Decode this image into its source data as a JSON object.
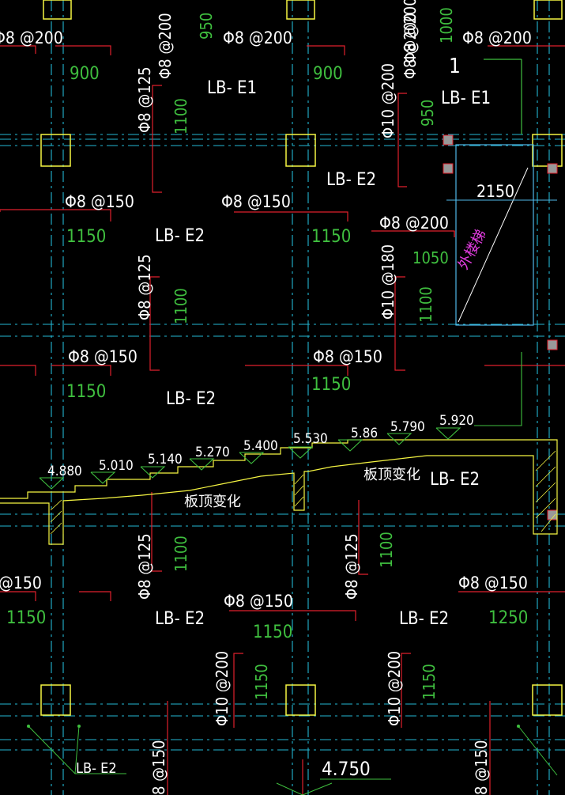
{
  "colors": {
    "background": "#000000",
    "grid_line": "#23b7d3",
    "rebar_line": "#e0202c",
    "column": "#f5f542",
    "dimension": "#3fbf3f",
    "text": "#ffffff",
    "magenta": "#e23ce0",
    "opening": "#4fb8e8"
  },
  "slabs": [
    {
      "label": "LB- E1"
    },
    {
      "label": "LB- E1"
    },
    {
      "label": "LB- E2"
    },
    {
      "label": "LB- E2"
    },
    {
      "label": "LB- E2"
    },
    {
      "label": "LB- E2"
    },
    {
      "label": "LB- E2"
    },
    {
      "label": "LB- E2"
    },
    {
      "label": "LB- E2"
    }
  ],
  "rebar_labels": [
    {
      "text": "Φ8 @200"
    },
    {
      "text": "Φ8 @200"
    },
    {
      "text": "Φ8 @200"
    },
    {
      "text": "Φ8 @200"
    },
    {
      "text": "Φ8 @200"
    },
    {
      "text": "Φ8 @200"
    },
    {
      "text": "Φ8 @125"
    },
    {
      "text": "Φ10 @200"
    },
    {
      "text": "Φ8 @150"
    },
    {
      "text": "Φ8 @150"
    },
    {
      "text": "Φ8 @200"
    },
    {
      "text": "Φ8 @125"
    },
    {
      "text": "Φ10 @180"
    },
    {
      "text": "Φ8 @150"
    },
    {
      "text": "Φ8 @150"
    },
    {
      "text": "Φ8 @125"
    },
    {
      "text": "Φ8 @125"
    },
    {
      "text": "@150"
    },
    {
      "text": "Φ8 @150"
    },
    {
      "text": "Φ8 @150"
    },
    {
      "text": "Φ10 @200"
    },
    {
      "text": "Φ10 @200"
    },
    {
      "text": "8 @150"
    },
    {
      "text": "8 @150"
    }
  ],
  "dimension_labels": [
    {
      "text": "950"
    },
    {
      "text": "1000"
    },
    {
      "text": "900"
    },
    {
      "text": "900"
    },
    {
      "text": "1100"
    },
    {
      "text": "950"
    },
    {
      "text": "1150"
    },
    {
      "text": "1150"
    },
    {
      "text": "1050"
    },
    {
      "text": "1100"
    },
    {
      "text": "1100"
    },
    {
      "text": "1150"
    },
    {
      "text": "1150"
    },
    {
      "text": "1100"
    },
    {
      "text": "1100"
    },
    {
      "text": "1150"
    },
    {
      "text": "1150"
    },
    {
      "text": "1250"
    },
    {
      "text": "1150"
    },
    {
      "text": "1150"
    }
  ],
  "elevations": [
    {
      "text": "4.880"
    },
    {
      "text": "5.010"
    },
    {
      "text": "5.140"
    },
    {
      "text": "5.270"
    },
    {
      "text": "5.400"
    },
    {
      "text": "5.530"
    },
    {
      "text": "5.86"
    },
    {
      "text": "5.790"
    },
    {
      "text": "5.920"
    }
  ],
  "notes": {
    "slab_top_change_1": "板顶变化",
    "slab_top_change_2": "板顶变化",
    "opening_width": "2150",
    "opening_text": "外楼梯",
    "detail_number": "1",
    "bottom_elevation": "4.750",
    "bottom_slab": "LB- E2"
  }
}
